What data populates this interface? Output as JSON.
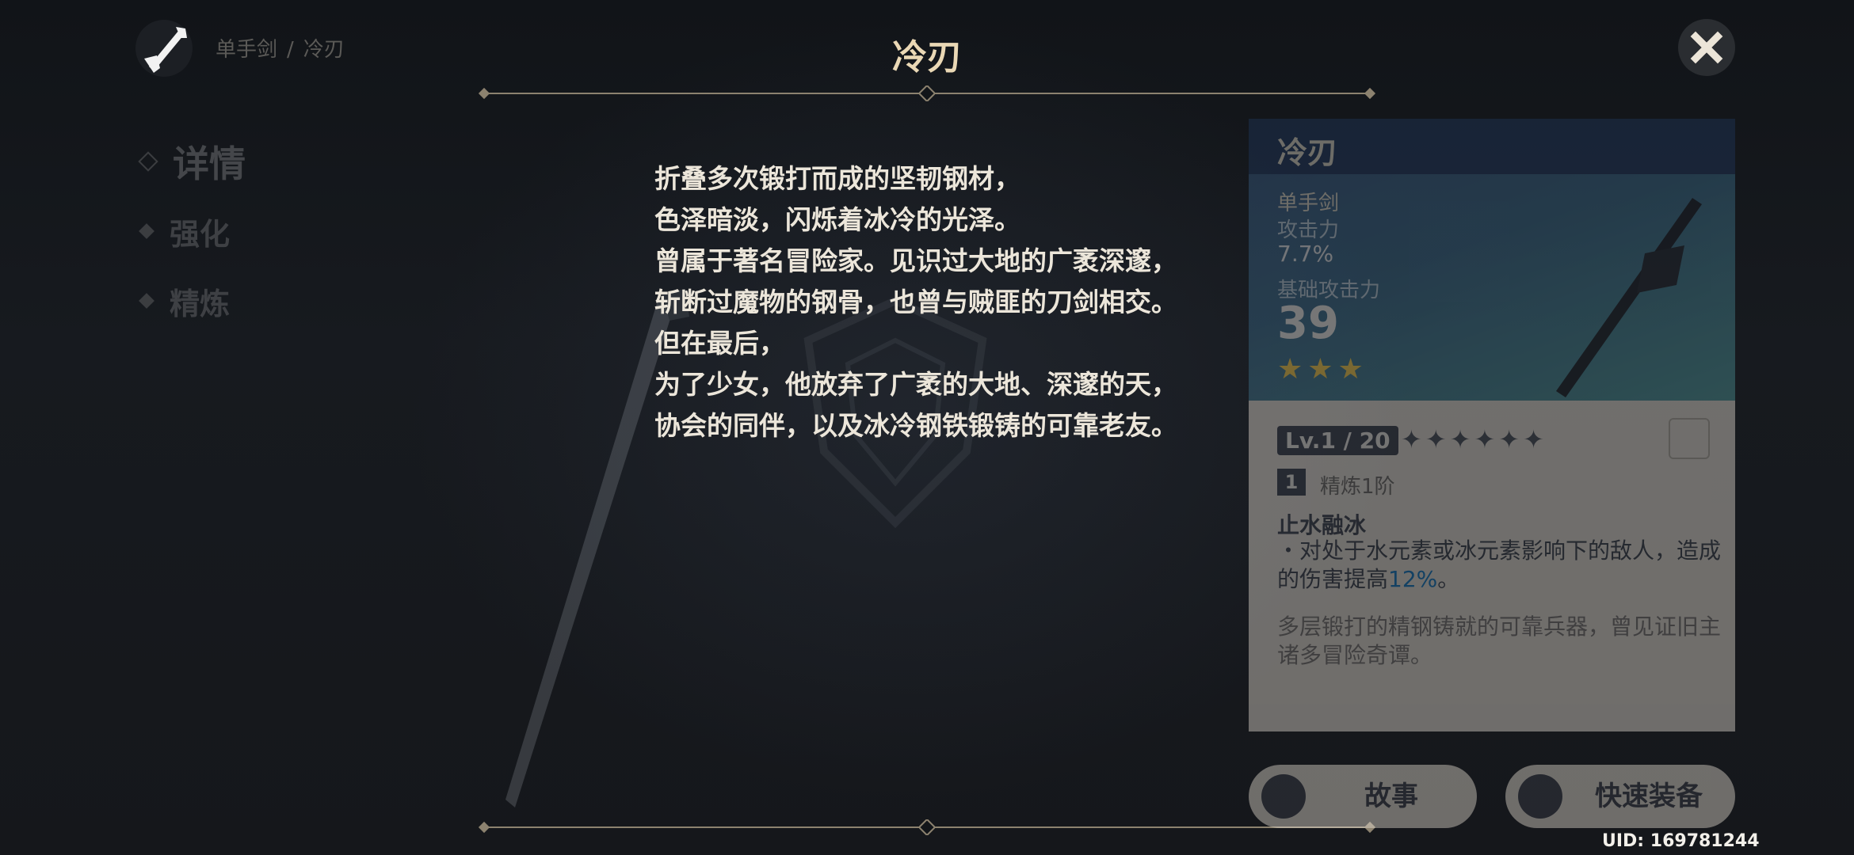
{
  "header": {
    "weapon_type_icon": "sword-icon",
    "breadcrumb": [
      "单手剑",
      "/",
      "冷刃"
    ],
    "title": "冷刃",
    "close_icon": "close-icon"
  },
  "tabs": [
    {
      "label": "详情",
      "active": true
    },
    {
      "label": "强化",
      "active": false
    },
    {
      "label": "精炼",
      "active": false
    }
  ],
  "story": {
    "lines": [
      "折叠多次锻打而成的坚韧钢材，",
      "色泽暗淡，闪烁着冰冷的光泽。",
      "曾属于著名冒险家。见识过大地的广袤深邃，",
      "斩断过魔物的钢骨，也曾与贼匪的刀剑相交。",
      "但在最后，",
      "为了少女，他放弃了广袤的大地、深邃的天，",
      "协会的同伴，以及冰冷钢铁锻铸的可靠老友。"
    ]
  },
  "card": {
    "name": "冷刃",
    "type": "单手剑",
    "substat_label": "攻击力",
    "substat_value": "7.7%",
    "base_atk_label": "基础攻击力",
    "base_atk_value": "39",
    "rarity": 3,
    "level": "Lv.1 / 20",
    "ascension_stars": 6,
    "refinement_badge": "1",
    "refinement_label": "精炼1阶",
    "passive_name": "止水融冰",
    "passive_desc_pre": "・对处于水元素或冰元素影响下的敌人，造成的伤害提高",
    "passive_desc_hl": "12%",
    "passive_desc_post": "。",
    "flavor": "多层锻打的精钢铸就的可靠兵器，曾见证旧主诸多冒险奇谭。",
    "colors": {
      "top": "#3a5a85",
      "teal": "#4f9a9a",
      "highlight": "#0f7ac3",
      "star": "#ffd24a"
    }
  },
  "buttons": {
    "story": {
      "label": "故事",
      "icon": "info-icon"
    },
    "equip": {
      "label": "快速装备",
      "icon": "ring-icon"
    }
  },
  "uid": "UID: 169781244"
}
